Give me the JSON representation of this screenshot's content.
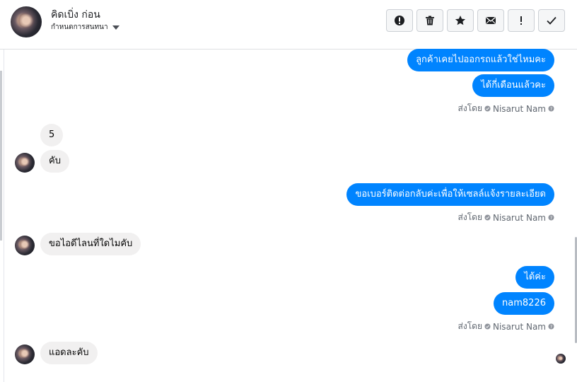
{
  "header": {
    "contact_name": "คิดเบิ่ง ก่อน",
    "label_select": "กำหนดการสนทนา"
  },
  "toolbar": [
    {
      "name": "spam-button",
      "icon": "alert-circle-icon"
    },
    {
      "name": "delete-button",
      "icon": "trash-icon"
    },
    {
      "name": "star-button",
      "icon": "star-icon"
    },
    {
      "name": "mark-unread-button",
      "icon": "envelope-icon"
    },
    {
      "name": "follow-up-button",
      "icon": "exclamation-icon"
    },
    {
      "name": "mark-done-button",
      "icon": "check-icon"
    }
  ],
  "messages": {
    "m1": "ลูกค้าเคยไปออกรถแล้วใช่ไหมคะ",
    "m2": "ได้กี่เดือนแล้วคะ",
    "m3": "5",
    "m4": "คับ",
    "m5": "ขอเบอร์ติดต่อกลับค่ะเพื่อให้เซลล์แจ้งรายละเอียด",
    "m6": "ขอไอดีไลนที่ใดไมคับ",
    "m7": "ได้ค่ะ",
    "m8": "nam8226",
    "m9": "แอดละคับ"
  },
  "sent_by": {
    "prefix": "ส่งโดย",
    "sender": "Nisarut Nam"
  },
  "colors": {
    "outgoing_bubble": "#0084ff",
    "incoming_bubble": "#f1f0f0"
  }
}
